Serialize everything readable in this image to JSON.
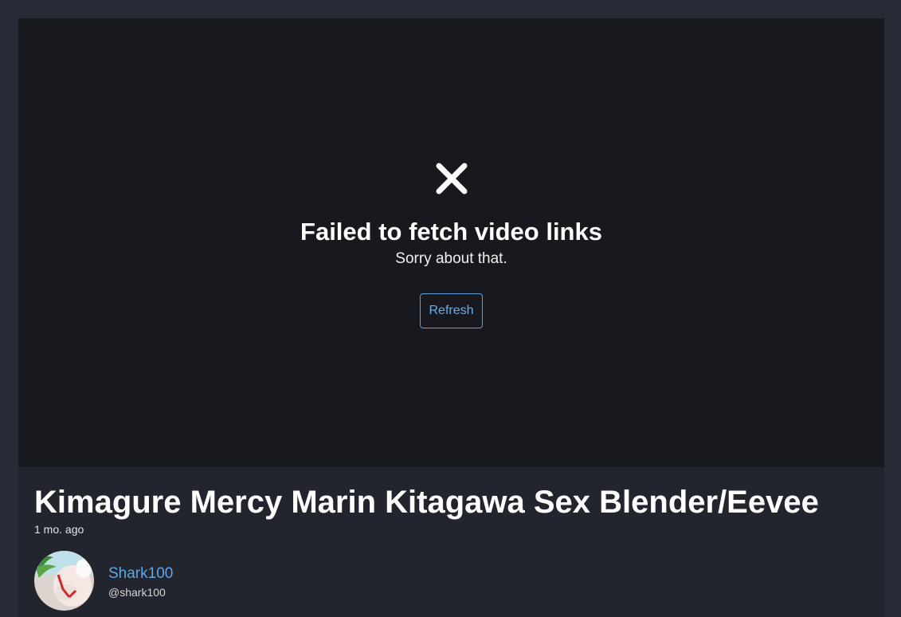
{
  "player": {
    "error_icon": "close-x-icon",
    "error_title": "Failed to fetch video links",
    "error_message": "Sorry about that.",
    "refresh_label": "Refresh"
  },
  "video": {
    "title": "Kimagure Mercy Marin Kitagawa Sex Blender/Eevee",
    "posted": "1 mo. ago"
  },
  "author": {
    "name": "Shark100",
    "handle": "@shark100"
  },
  "colors": {
    "page_bg": "#282b35",
    "card_bg": "#23252e",
    "player_bg": "#18191e",
    "link": "#5ea6e8"
  }
}
